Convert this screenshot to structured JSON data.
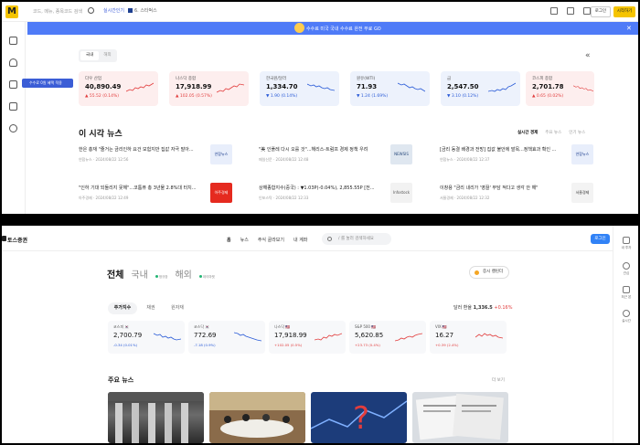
{
  "top": {
    "header": {
      "logo": "M",
      "search_placeholder": "코드, 메뉴, 종목코드 검색",
      "realtime_label": "실시간인기",
      "realtime_rank": "6. 스타벅스",
      "login": "로그인",
      "signup": "시작하기"
    },
    "banner": {
      "text": "수수료 미국 국내 수수료 완전 무료 GO"
    },
    "tooltip": "수수료 0원 혜택 적용",
    "segment": {
      "on": "국내",
      "off": "해외"
    },
    "cards": [
      {
        "name": "다우 산업",
        "value": "40,890.49",
        "change": "▲ 55.52 (0.14%)",
        "dir": "up"
      },
      {
        "name": "나스닥 종합",
        "value": "17,918.99",
        "change": "▲ 102.05 (0.57%)",
        "dir": "up"
      },
      {
        "name": "한국원/달러",
        "value": "1,334.70",
        "change": "▼ 1.90 (0.14%)",
        "dir": "dn"
      },
      {
        "name": "원유(WTI)",
        "value": "71.93",
        "change": "▼ 1.24 (1.69%)",
        "dir": "dn"
      },
      {
        "name": "금",
        "value": "2,547.50",
        "change": "▼ 3.10 (0.12%)",
        "dir": "dn"
      },
      {
        "name": "코스피 종합",
        "value": "2,701.78",
        "change": "▲ 0.65 (0.02%)",
        "dir": "up"
      }
    ],
    "news": {
      "title": "이 시각 뉴스",
      "tabs": [
        "실시간 경제",
        "주요 뉴스",
        "인기 뉴스"
      ],
      "items": [
        {
          "headline": "한은 총재 \"줄거는 금리인하 요건 모험지만 집값 자극 말아...",
          "meta": "연합뉴스 · 2024/08/22 12:56",
          "thumb": "연합뉴스"
        },
        {
          "headline": "\"美 인플레 다시 오를 것\"...해리스-트럼프 경제 정책 우려",
          "meta": "매일신문 · 2024/08/22 12:48",
          "thumb": "NEWSIS"
        },
        {
          "headline": "[금리 동결 배경과 전망] 집값 불안에 발목...정책효과 확인 ...",
          "meta": "연합뉴스 · 2024/08/22 12:37",
          "thumb": "연합뉴스"
        },
        {
          "headline": "\"인하 기대 되돌리지 못해\"...코툼퓨 총 3년물 2.8%대 터치...",
          "meta": "아주경제 · 2024/08/22 12:49",
          "thumb": "아주경제"
        },
        {
          "headline": "상해종합지수(중국) : ▼1.03P(-0.04%), 2,855.55P [전...",
          "meta": "인포스탁 · 2024/08/22 12:33",
          "thumb": "Infostock"
        },
        {
          "headline": "이창용 \"금리 내리가 '영끌' 부담 적다고 생각 안 해\"",
          "meta": "서울경제 · 2024/08/22 12:32",
          "thumb": "서울경제"
        }
      ]
    }
  },
  "bottom": {
    "header": {
      "logo": "토스증권",
      "nav": [
        "홈",
        "뉴스",
        "주식 골라보기",
        "내 계좌"
      ],
      "search_placeholder": "/ 를 눌러 검색하세요",
      "login": "로그인"
    },
    "rail": [
      "내 투자",
      "관심",
      "최근 본",
      "실시간"
    ],
    "tabs": [
      {
        "label": "전체",
        "sub": ""
      },
      {
        "label": "국내",
        "sub": "정규장"
      },
      {
        "label": "해외",
        "sub": "데이마켓"
      }
    ],
    "hours_button": "증시 캘린더",
    "chips": [
      "주가지수",
      "채권",
      "원자재"
    ],
    "fx": {
      "label": "달러 환율",
      "value": "1,336.5",
      "change": "+0.16%"
    },
    "cards": [
      {
        "name": "코스피 🇰🇷",
        "value": "2,700.79",
        "change": "-0.34 (0.01%)",
        "dir": "dn"
      },
      {
        "name": "코스닥 🇰🇷",
        "value": "772.69",
        "change": "-7.18 (0.9%)",
        "dir": "dn"
      },
      {
        "name": "나스닥 🇺🇸",
        "value": "17,918.99",
        "change": "+102.05 (0.5%)",
        "dir": "up"
      },
      {
        "name": "S&P 500 🇺🇸",
        "value": "5,620.85",
        "change": "+23.73 (0.4%)",
        "dir": "up"
      },
      {
        "name": "VIX 🇺🇸",
        "value": "16.27",
        "change": "+0.39 (2.4%)",
        "dir": "up"
      }
    ],
    "news": {
      "title": "주요 뉴스",
      "more": "더 보기"
    },
    "colors": {
      "accent": "#3182f6",
      "up": "#e23d3d",
      "down": "#2a5bd7"
    }
  }
}
